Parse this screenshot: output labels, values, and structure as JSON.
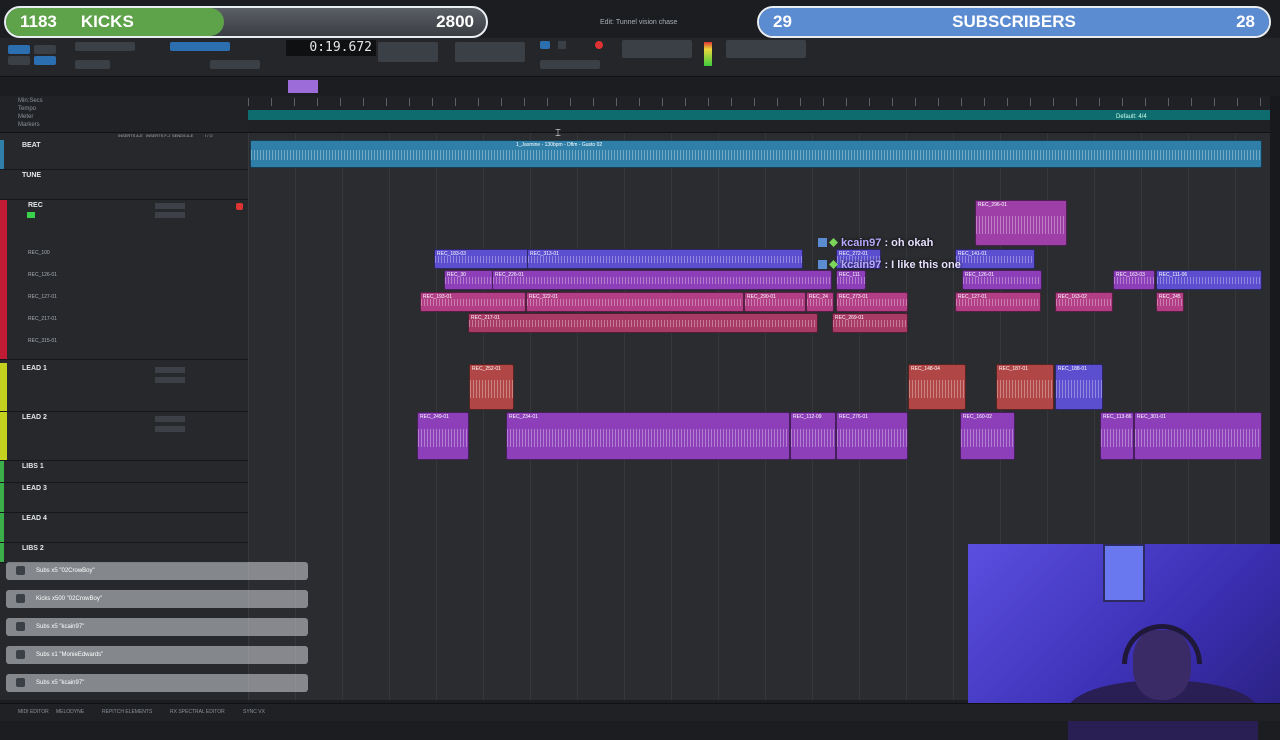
{
  "overlay": {
    "kicks": {
      "count": "1183",
      "label": "KICKS",
      "goal": "2800"
    },
    "subs": {
      "count": "29",
      "label": "SUBSCRIBERS",
      "goal": "28"
    }
  },
  "window": {
    "title": "Edit: Tunnel vision chase"
  },
  "transport": {
    "counter": "0:19.672"
  },
  "ruler": {
    "rows": [
      "Min:Secs",
      "Tempo",
      "Meter",
      "Markers"
    ],
    "default_label": "Default: 4/4"
  },
  "header": {
    "inserts_ae": "INSERTS A-E",
    "inserts_fj": "INSERTS F-J",
    "sends_ae": "SENDS A-E",
    "io": "I / O"
  },
  "tracks": [
    {
      "name": "BEAT"
    },
    {
      "name": "TUNE"
    },
    {
      "name": "REC",
      "playlists": [
        "REC_100",
        "REC_126-01",
        "REC_127-01",
        "REC_217-01",
        "REC_315-01"
      ]
    },
    {
      "name": "LEAD 1"
    },
    {
      "name": "LEAD 2"
    },
    {
      "name": "LIBS 1"
    },
    {
      "name": "LEAD 3"
    },
    {
      "name": "LEAD 4"
    },
    {
      "name": "LIBS 2"
    }
  ],
  "clips": {
    "beat": "1_Jasmine - 130bpm - Dflm - Gusto 02",
    "rec_top": "REC_296-01",
    "r1a": "REC_183-03",
    "r1b": "REC_313-01",
    "r1c": "REC_272-01",
    "r1d": "REC_141-01",
    "r2a": "REC_30",
    "r2b": "REC_226-01",
    "r2c": "REC_111",
    "r2d": "REC_126-01",
    "r2e": "REC_163-03",
    "r2f": "REC_111-06",
    "r3a": "REC_193-01",
    "r3b": "REC_322-01",
    "r3c": "REC_290-01",
    "r3d": "REC_24",
    "r3e": "REC_273-01",
    "r3f": "REC_127-01",
    "r3g": "REC_163-02",
    "r3h": "REC_245",
    "r4a": "REC_217-01",
    "r4b": "REC_269-01",
    "l1a": "REC_252-01",
    "l1b": "REC_148-04",
    "l1c": "REC_187-01",
    "l1d": "REC_188-01",
    "l2a": "REC_249-01",
    "l2b": "REC_234-01",
    "l2c": "REC_112-09",
    "l2d": "REC_276-01",
    "l2e": "REC_160-02",
    "l2f": "REC_113-86",
    "l2g": "REC_301-01",
    "db": "0 dB"
  },
  "chat": [
    {
      "user": "kcain97",
      "sep": ":",
      "msg": "oh okah"
    },
    {
      "user": "kcain97",
      "sep": ":",
      "msg": "I like this one"
    }
  ],
  "alerts": [
    "Subs x5 \"02CrowBoy\"",
    "Kicks x500 \"02CrowBoy\"",
    "Subs x5 \"kcain97\"",
    "Subs x1 \"MonieEdwards\"",
    "Subs x5 \"kcain97\""
  ],
  "bottom": [
    "MIDI EDITOR",
    "MELODYNE",
    "REPITCH ELEMENTS",
    "RX SPECTRAL EDITOR",
    "SYNC VX"
  ],
  "colors": {
    "kicks": "#5ea24a",
    "subs": "#5b8bd1",
    "rec": "#c21b36",
    "lead": "#c4d21f",
    "beat": "#2f7fa8"
  },
  "icons": [
    "cursor-icon",
    "record-icon",
    "play-icon",
    "stop-icon",
    "alert-gift-icon"
  ]
}
